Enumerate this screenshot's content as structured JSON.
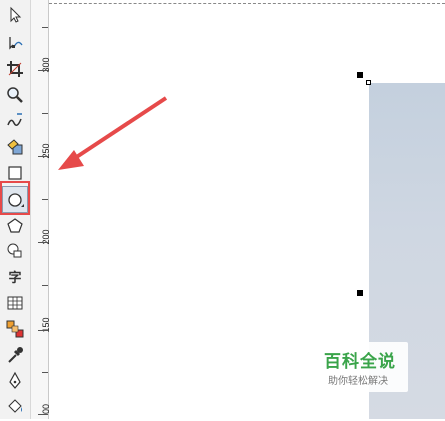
{
  "toolbox": {
    "tools": [
      {
        "name": "pick-tool",
        "icon": "pointer-arrow-icon"
      },
      {
        "name": "shape-tool",
        "icon": "shape-node-icon"
      },
      {
        "name": "crop-tool",
        "icon": "crop-icon"
      },
      {
        "name": "zoom-tool",
        "icon": "magnifier-icon"
      },
      {
        "name": "freehand-tool",
        "icon": "freehand-curve-icon"
      },
      {
        "name": "smart-fill-tool",
        "icon": "smart-fill-icon"
      },
      {
        "name": "rectangle-tool",
        "icon": "rectangle-icon"
      },
      {
        "name": "ellipse-tool",
        "icon": "ellipse-icon",
        "active": true
      },
      {
        "name": "polygon-tool",
        "icon": "polygon-icon"
      },
      {
        "name": "basic-shapes-tool",
        "icon": "basic-shapes-icon"
      },
      {
        "name": "text-tool",
        "icon": "text-icon",
        "label": "字"
      },
      {
        "name": "table-tool",
        "icon": "table-icon"
      },
      {
        "name": "blend-tool",
        "icon": "blend-icon"
      },
      {
        "name": "eyedropper-tool",
        "icon": "eyedropper-icon"
      },
      {
        "name": "outline-pen-tool",
        "icon": "pen-nib-icon"
      },
      {
        "name": "fill-tool",
        "icon": "paint-bucket-icon"
      }
    ],
    "highlight_color": "#e64a4a",
    "arrow_color": "#e64a4a"
  },
  "ruler": {
    "labels": [
      "300",
      "250",
      "200",
      "150",
      "00"
    ]
  },
  "watermark": {
    "title": "百科全说",
    "subtitle": "助你轻松解决",
    "title_color": "#3aa44a"
  }
}
